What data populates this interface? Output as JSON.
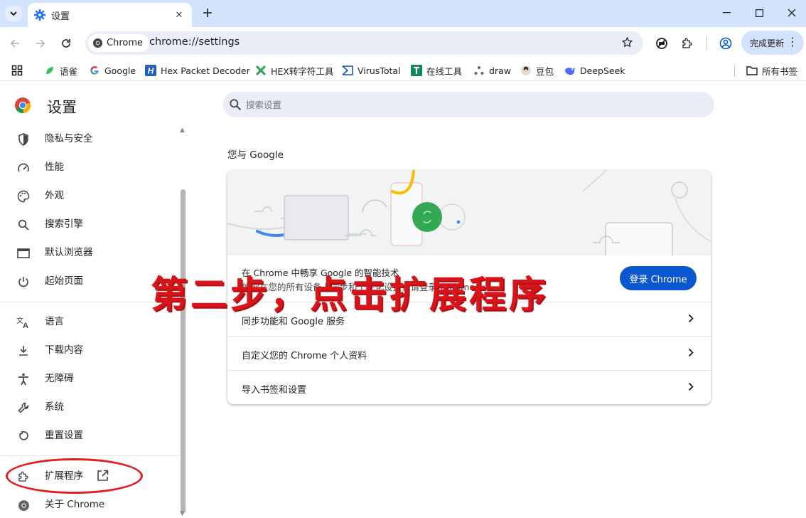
{
  "tab": {
    "title": "设置",
    "close": "✕",
    "new": "+"
  },
  "window": {
    "minimize": "—",
    "maximize": "☐",
    "close": "✕"
  },
  "address": {
    "chip": "Chrome",
    "url": "chrome://settings"
  },
  "update": {
    "label": "完成更新",
    "menu": "⋮"
  },
  "bookmarks": [
    {
      "label": "语雀",
      "icon": "yuque-icon",
      "color": "#3dbf5a"
    },
    {
      "label": "Google",
      "icon": "google-icon",
      "color": "#4285f4"
    },
    {
      "label": "Hex Packet Decoder",
      "icon": "h-logo-icon",
      "color": "#1f5fbf"
    },
    {
      "label": "HEX转字符工具",
      "icon": "x-logo-icon",
      "color": "#34a853"
    },
    {
      "label": "VirusTotal",
      "icon": "virustotal-icon",
      "color": "#1557c0"
    },
    {
      "label": "在线工具",
      "icon": "t-logo-icon",
      "color": "#11885a"
    },
    {
      "label": "draw",
      "icon": "draw-icon",
      "color": "#5f6368"
    },
    {
      "label": "豆包",
      "icon": "doubao-icon",
      "color": "#444444"
    },
    {
      "label": "DeepSeek",
      "icon": "deepseek-icon",
      "color": "#4d6bfe"
    }
  ],
  "all_bookmarks": "所有书签",
  "sidebar": {
    "title": "设置",
    "items": [
      {
        "label": "隐私与安全",
        "icon": "shield-icon"
      },
      {
        "label": "性能",
        "icon": "speedometer-icon"
      },
      {
        "label": "外观",
        "icon": "palette-icon"
      },
      {
        "label": "搜索引擎",
        "icon": "search-icon"
      },
      {
        "label": "默认浏览器",
        "icon": "browser-window-icon"
      },
      {
        "label": "起始页面",
        "icon": "power-icon"
      },
      {
        "label": "语言",
        "icon": "translate-icon"
      },
      {
        "label": "下载内容",
        "icon": "download-icon"
      },
      {
        "label": "无障碍",
        "icon": "accessibility-icon"
      },
      {
        "label": "系统",
        "icon": "wrench-icon"
      },
      {
        "label": "重置设置",
        "icon": "reset-icon"
      },
      {
        "label": "扩展程序",
        "icon": "puzzle-icon"
      },
      {
        "label": "关于 Chrome",
        "icon": "chrome-icon"
      }
    ]
  },
  "search": {
    "placeholder": "搜索设置"
  },
  "main": {
    "section_title": "您与 Google",
    "signin_line1": "在 Chrome 中畅享 Google 的智能技术",
    "signin_line2": "如需在您的所有设备上同步和个性化设置，请登录 Chrome",
    "signin_button": "登录 Chrome",
    "rows": [
      "同步功能和 Google 服务",
      "自定义您的 Chrome 个人资料",
      "导入书签和设置"
    ]
  },
  "annotation": {
    "text": "第二步，点击扩展程序",
    "color": "#d8141b"
  }
}
